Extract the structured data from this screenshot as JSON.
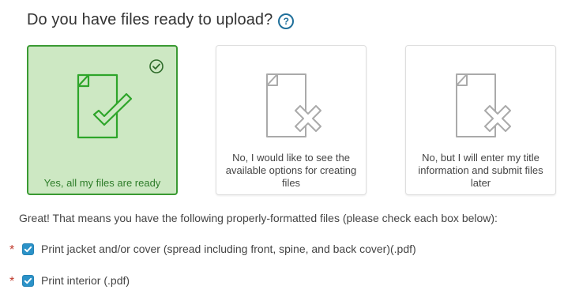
{
  "question": {
    "text": "Do you have files ready to upload?",
    "help_icon": "question-circle-icon"
  },
  "options": [
    {
      "label": "Yes, all my files are ready",
      "icon": "document-check-icon",
      "selected": true
    },
    {
      "label": "No, I would like to see the available options for creating files",
      "icon": "document-x-icon",
      "selected": false
    },
    {
      "label": "No, but I will enter my title information and submit files later",
      "icon": "document-x-icon",
      "selected": false
    }
  ],
  "files_intro": "Great! That means you have the following properly-formatted files (please check each box below):",
  "file_checks": [
    {
      "label": "Print jacket and/or cover (spread including front, spine, and back cover)(.pdf)",
      "checked": true,
      "required": true
    },
    {
      "label": "Print interior (.pdf)",
      "checked": true,
      "required": true
    }
  ],
  "required_marker": "*",
  "colors": {
    "selected_bg": "#cde8c3",
    "selected_border": "#3a9a33",
    "check_green": "#2ea52a",
    "checkbox_blue": "#2b92c8",
    "required_red": "#c0392b",
    "help_blue": "#1f6f9a",
    "icon_gray": "#aaaaaa"
  }
}
